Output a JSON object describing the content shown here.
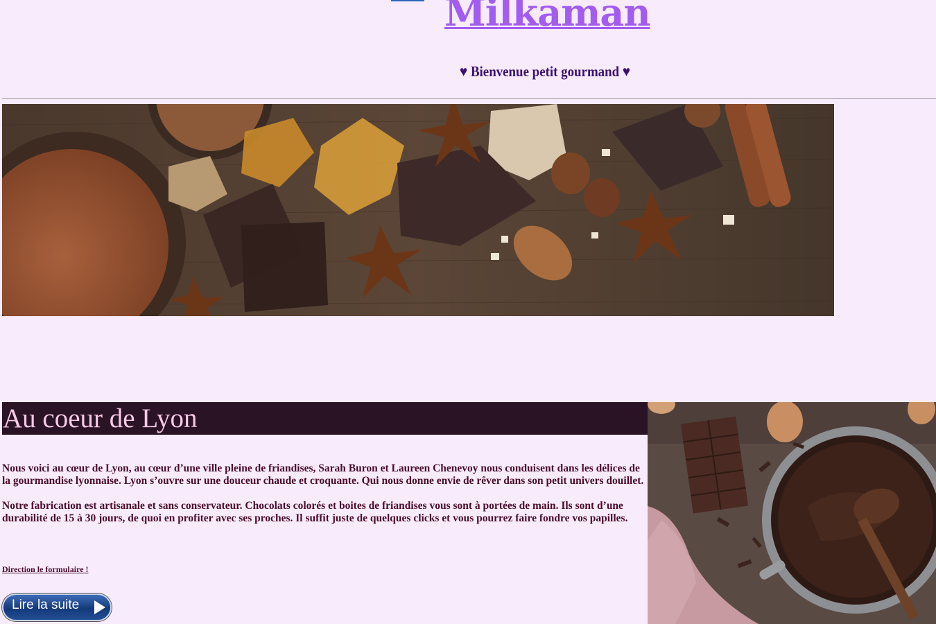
{
  "header": {
    "site_title": "Milkaman",
    "welcome": "♥ Bienvenue petit gourmand ♥"
  },
  "hero": {
    "description": "chocolate-spices-banner"
  },
  "section": {
    "heading": "Au coeur de Lyon",
    "paragraphs": [
      "Nous voici au cœur de Lyon, au cœur d’une ville pleine de friandises, Sarah Buron et Laureen Chenevoy nous conduisent dans les délices de la gourmandise lyonnaise. Lyon s’ouvre sur une douceur chaude et croquante. Qui nous donne envie de rêver dans son petit univers douillet.",
      "Notre fabrication est artisanale et sans conservateur. Chocolats colorés et boites de friandises vous sont à portées de main. Ils sont d’une durabilité de 15 à 30 jours, de quoi en profiter avec ses proches. Il suffit juste de quelques clicks et vous pourrez faire fondre vos papilles."
    ],
    "form_link": "Direction le formulaire !",
    "read_more_label": "Lire la suite",
    "read_more_icon": "play-arrow-icon"
  },
  "colors": {
    "background": "#f8ecfc",
    "title": "#a35cf0",
    "welcome": "#3c1170",
    "heading_bg": "#2b1326",
    "heading_text": "#f5c9e6",
    "body_text": "#4a0d2f"
  }
}
